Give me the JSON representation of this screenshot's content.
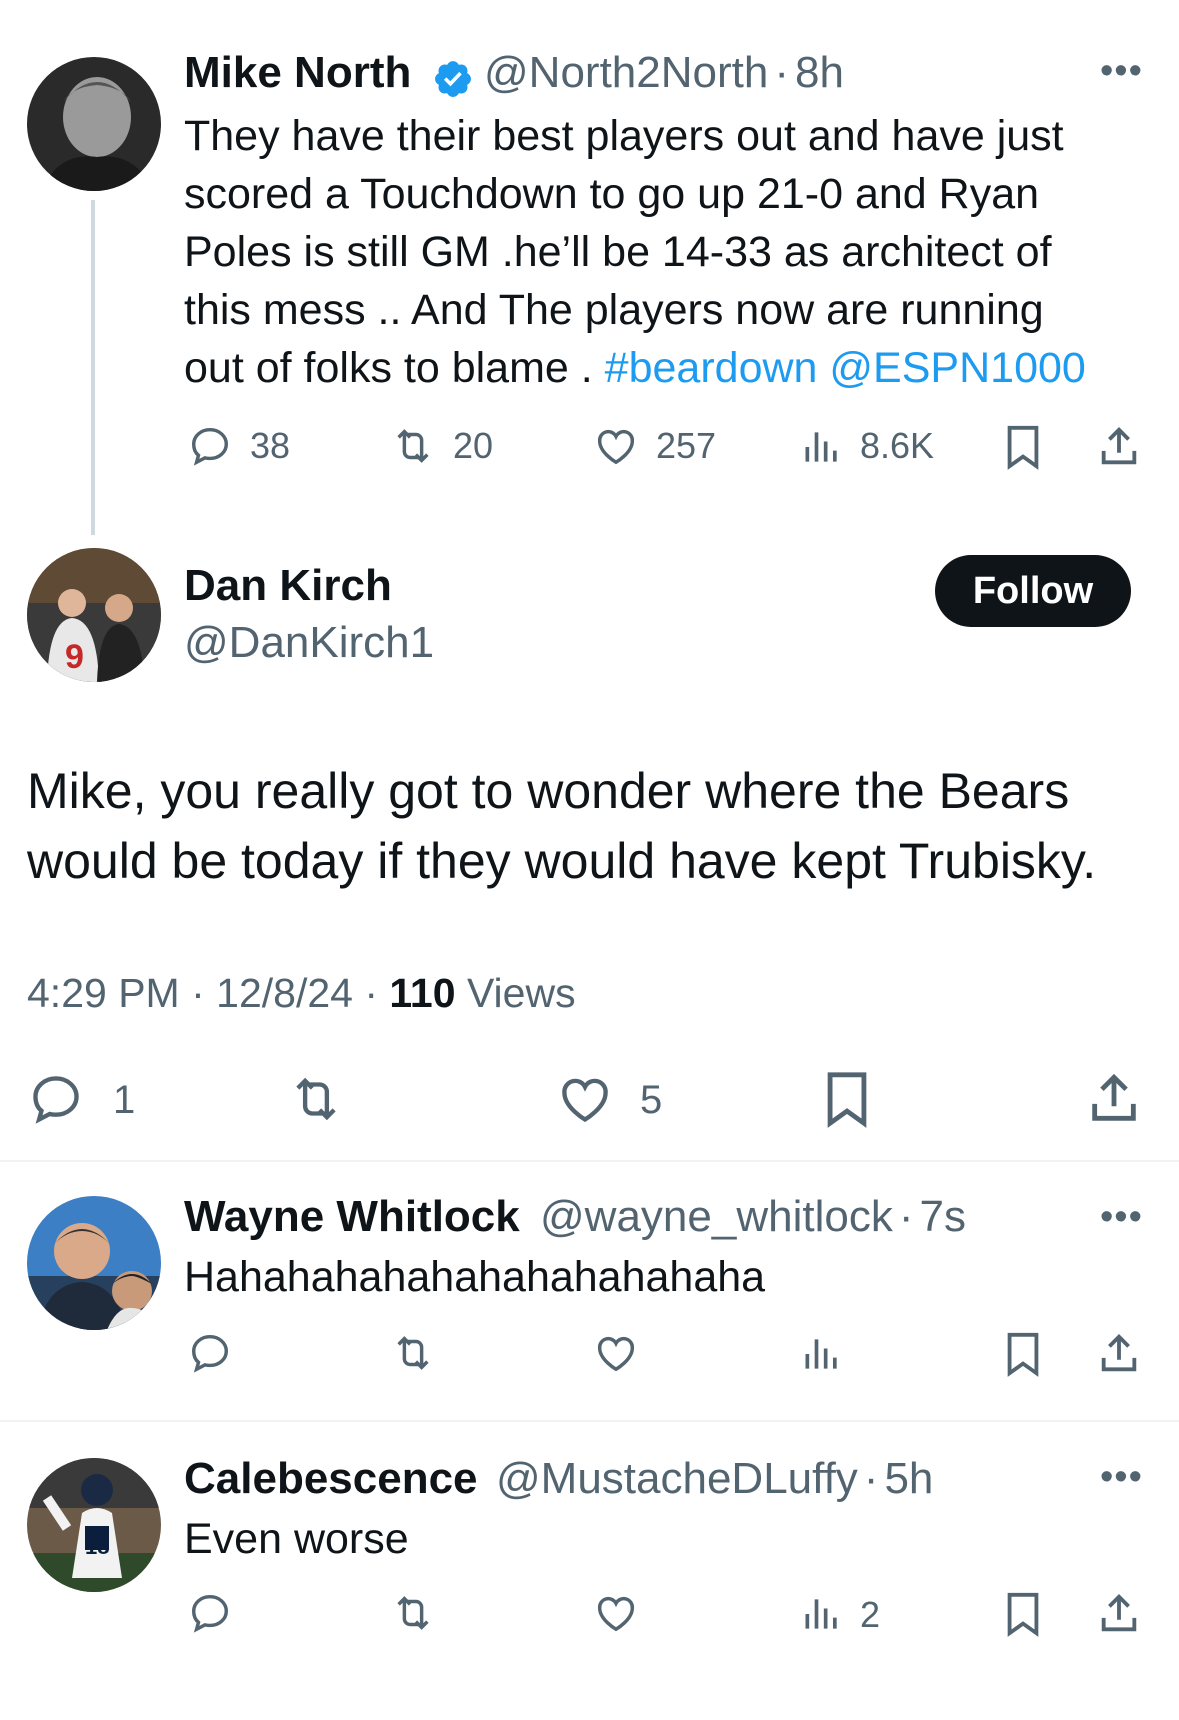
{
  "tweet_main": {
    "name": "Mike North",
    "handle": "@North2North",
    "sep": "·",
    "time": "8h",
    "text_lines": [
      "They have their best players out and have just",
      "scored a Touchdown to go up 21-0 and Ryan",
      "Poles is still GM .he’ll be 14-33 as architect of",
      "this mess .. And The  players now are running",
      "out of folks to blame . "
    ],
    "hashtag": "#beardown",
    "mention": "@ESPN1000",
    "replies": "38",
    "retweets": "20",
    "likes": "257",
    "views": "8.6K"
  },
  "reply_focus": {
    "name": "Dan Kirch",
    "handle": "@DanKirch1",
    "follow_label": "Follow",
    "text_line1": "Mike, you really got to wonder where the Bears",
    "text_line2": "would be today if they would have kept Trubisky.",
    "time": "4:29 PM",
    "date": "12/8/24",
    "views_count": "110",
    "views_label": "Views",
    "replies": "1",
    "likes": "5"
  },
  "reply_wayne": {
    "name": "Wayne Whitlock",
    "handle": "@wayne_whitlock",
    "sep": "·",
    "time": "7s",
    "text": "Hahahahahahahahahahahaha"
  },
  "reply_caleb": {
    "name": "Calebescence",
    "handle": "@MustacheDLuffy",
    "sep": "·",
    "time": "5h",
    "text": "Even worse",
    "views": "2"
  },
  "colors": {
    "accent": "#1d9bf0",
    "text": "#0f1419",
    "secondary": "#536471",
    "divider": "#eff3f4"
  },
  "icons": [
    "reply-icon",
    "retweet-icon",
    "like-icon",
    "views-icon",
    "bookmark-icon",
    "share-icon",
    "more-icon",
    "verified-icon"
  ]
}
